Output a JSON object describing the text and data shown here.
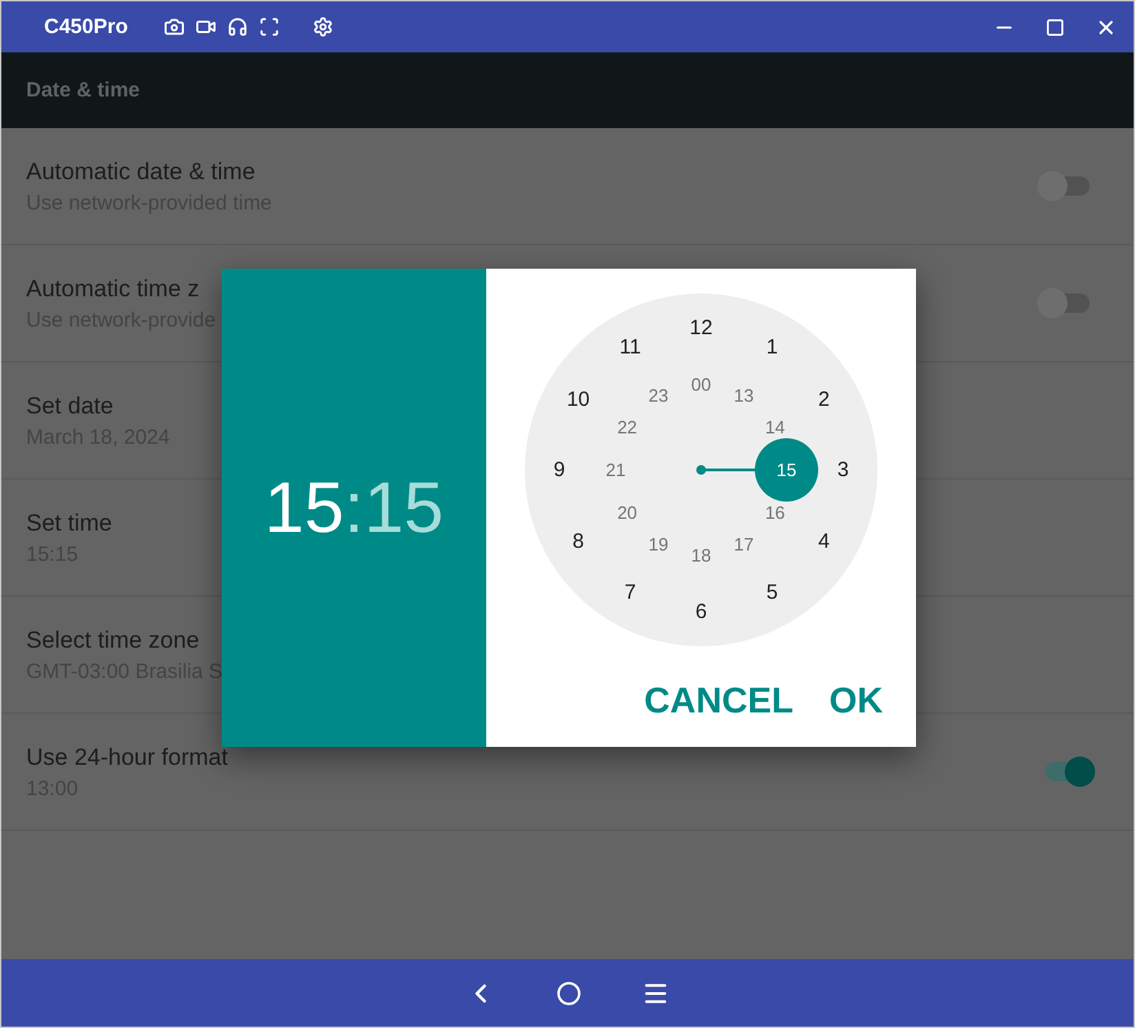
{
  "window": {
    "title": "C450Pro"
  },
  "app_bar": {
    "title": "Date & time"
  },
  "settings": [
    {
      "title": "Automatic date & time",
      "summary": "Use network-provided time",
      "kind": "switch",
      "on": false
    },
    {
      "title": "Automatic time z",
      "summary": "Use network-provide",
      "kind": "switch",
      "on": false
    },
    {
      "title": "Set date",
      "summary": "March 18, 2024",
      "kind": "plain"
    },
    {
      "title": "Set time",
      "summary": "15:15",
      "kind": "plain"
    },
    {
      "title": "Select time zone",
      "summary": "GMT-03:00 Brasilia S",
      "kind": "plain"
    },
    {
      "title": "Use 24-hour format",
      "summary": "13:00",
      "kind": "switch",
      "on": true
    }
  ],
  "dialog": {
    "header": {
      "hour": {
        "text": "15",
        "selected": true
      },
      "separator": ":",
      "minute": {
        "text": "15",
        "selected": false
      }
    },
    "outer": [
      {
        "text": "12",
        "selected": false
      },
      {
        "text": "1",
        "selected": false
      },
      {
        "text": "2",
        "selected": false
      },
      {
        "text": "3",
        "selected": false
      },
      {
        "text": "4",
        "selected": false
      },
      {
        "text": "5",
        "selected": false
      },
      {
        "text": "6",
        "selected": false
      },
      {
        "text": "7",
        "selected": false
      },
      {
        "text": "8",
        "selected": false
      },
      {
        "text": "9",
        "selected": false
      },
      {
        "text": "10",
        "selected": false
      },
      {
        "text": "11",
        "selected": false
      }
    ],
    "inner": [
      {
        "text": "00",
        "selected": false
      },
      {
        "text": "13",
        "selected": false
      },
      {
        "text": "14",
        "selected": false
      },
      {
        "text": "15",
        "selected": true
      },
      {
        "text": "16",
        "selected": false
      },
      {
        "text": "17",
        "selected": false
      },
      {
        "text": "18",
        "selected": false
      },
      {
        "text": "19",
        "selected": false
      },
      {
        "text": "20",
        "selected": false
      },
      {
        "text": "21",
        "selected": false
      },
      {
        "text": "22",
        "selected": false
      },
      {
        "text": "23",
        "selected": false
      }
    ],
    "buttons": [
      "CANCEL",
      "OK"
    ]
  }
}
